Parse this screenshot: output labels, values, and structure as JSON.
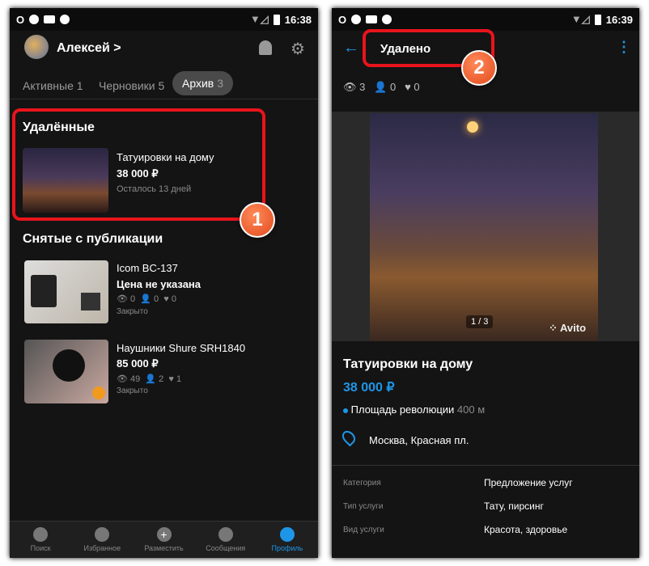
{
  "left": {
    "status": {
      "time": "16:38"
    },
    "header": {
      "user": "Алексей",
      "chevron": ">"
    },
    "tabs": [
      {
        "label": "Активные",
        "count": "1"
      },
      {
        "label": "Черновики",
        "count": "5"
      },
      {
        "label": "Архив",
        "count": "3",
        "active": true
      }
    ],
    "deleted_section": {
      "title": "Удалённые",
      "item": {
        "title": "Татуировки на дому",
        "price": "38 000 ₽",
        "note": "Осталось 13 дней"
      }
    },
    "unpublished_section": {
      "title": "Снятые с публикации",
      "items": [
        {
          "title": "Icom BC-137",
          "price": "Цена не указана",
          "views": "0",
          "contacts": "0",
          "favs": "0",
          "status": "Закрыто"
        },
        {
          "title": "Наушники Shure SRH1840",
          "price": "85 000 ₽",
          "views": "49",
          "contacts": "2",
          "favs": "1",
          "status": "Закрыто"
        }
      ]
    },
    "nav": [
      {
        "label": "Поиск",
        "icon": "search-icon"
      },
      {
        "label": "Избранное",
        "icon": "heart-icon"
      },
      {
        "label": "Разместить",
        "icon": "plus-icon"
      },
      {
        "label": "Сообщения",
        "icon": "chat-icon"
      },
      {
        "label": "Профиль",
        "icon": "profile-icon",
        "active": true
      }
    ],
    "callout": "1"
  },
  "right": {
    "status": {
      "time": "16:39"
    },
    "header": {
      "title": "Удалено"
    },
    "stats": {
      "views": "3",
      "contacts": "0",
      "favs": "0"
    },
    "gallery": {
      "counter": "1 / 3",
      "watermark": "Avito"
    },
    "title": "Татуировки на дому",
    "price": "38 000 ₽",
    "metro": {
      "station": "Площадь революции",
      "distance": "400 м"
    },
    "address": "Москва, Красная пл.",
    "params": [
      {
        "key": "Категория",
        "value": "Предложение услуг"
      },
      {
        "key": "Тип услуги",
        "value": "Тату, пирсинг"
      },
      {
        "key": "Вид услуги",
        "value": "Красота, здоровье"
      }
    ],
    "callout": "2"
  },
  "colors": {
    "accent": "#1e96e8",
    "highlight": "#e8141c",
    "callout": "#e8561f",
    "background": "#141414"
  }
}
